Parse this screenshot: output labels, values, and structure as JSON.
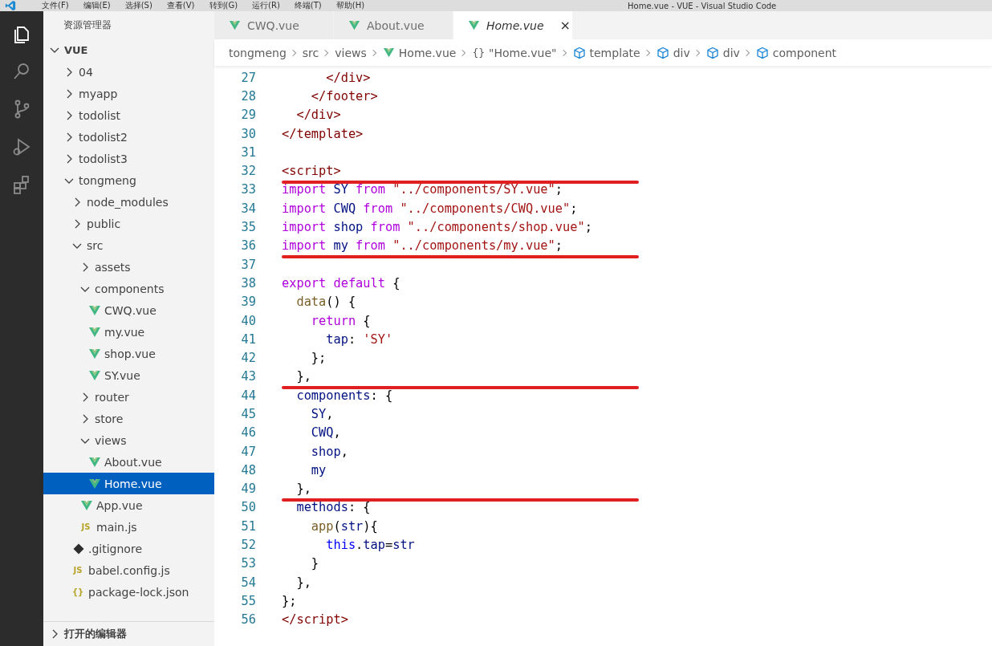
{
  "menu_bar": {
    "items": [
      "文件(F)",
      "编辑(E)",
      "选择(S)",
      "查看(V)",
      "转到(G)",
      "运行(R)",
      "终端(T)",
      "帮助(H)"
    ],
    "title": "Home.vue - VUE - Visual Studio Code"
  },
  "activity_bar": [
    {
      "kind": "files",
      "selected": true
    },
    {
      "kind": "search",
      "selected": false
    },
    {
      "kind": "source-control",
      "selected": false
    },
    {
      "kind": "run",
      "selected": false
    },
    {
      "kind": "extensions",
      "selected": false
    }
  ],
  "sidebar": {
    "title": "资源管理器",
    "root": {
      "label": "VUE",
      "expanded": true
    },
    "items": [
      {
        "label": "04",
        "kind": "folder",
        "expanded": false,
        "selected": false
      },
      {
        "label": "myapp",
        "kind": "folder",
        "expanded": false,
        "selected": false
      },
      {
        "label": "todolist",
        "kind": "folder",
        "expanded": false,
        "selected": false
      },
      {
        "label": "todolist2",
        "kind": "folder",
        "expanded": false,
        "selected": false
      },
      {
        "label": "todolist3",
        "kind": "folder",
        "expanded": false,
        "selected": false
      },
      {
        "label": "tongmeng",
        "kind": "folder",
        "expanded": true,
        "selected": false,
        "children": [
          {
            "label": "node_modules",
            "kind": "folder",
            "expanded": false,
            "selected": false
          },
          {
            "label": "public",
            "kind": "folder",
            "expanded": false,
            "selected": false
          },
          {
            "label": "src",
            "kind": "folder",
            "expanded": true,
            "selected": false,
            "children": [
              {
                "label": "assets",
                "kind": "folder",
                "expanded": false,
                "selected": false
              },
              {
                "label": "components",
                "kind": "folder",
                "expanded": true,
                "selected": false,
                "children": [
                  {
                    "label": "CWQ.vue",
                    "kind": "vue",
                    "selected": false
                  },
                  {
                    "label": "my.vue",
                    "kind": "vue",
                    "selected": false
                  },
                  {
                    "label": "shop.vue",
                    "kind": "vue",
                    "selected": false
                  },
                  {
                    "label": "SY.vue",
                    "kind": "vue",
                    "selected": false
                  }
                ]
              },
              {
                "label": "router",
                "kind": "folder",
                "expanded": false,
                "selected": false
              },
              {
                "label": "store",
                "kind": "folder",
                "expanded": false,
                "selected": false
              },
              {
                "label": "views",
                "kind": "folder",
                "expanded": true,
                "selected": false,
                "children": [
                  {
                    "label": "About.vue",
                    "kind": "vue",
                    "selected": false
                  },
                  {
                    "label": "Home.vue",
                    "kind": "vue",
                    "selected": true
                  }
                ]
              },
              {
                "label": "App.vue",
                "kind": "vue",
                "selected": false
              },
              {
                "label": "main.js",
                "kind": "badge",
                "badge": "JS",
                "selected": false
              }
            ]
          },
          {
            "label": ".gitignore",
            "kind": "git",
            "selected": false
          },
          {
            "label": "babel.config.js",
            "kind": "badge",
            "badge": "JS",
            "selected": false
          },
          {
            "label": "package-lock.json",
            "kind": "badge",
            "badge": "{}",
            "selected": false
          }
        ]
      }
    ],
    "open_editors": {
      "label": "打开的编辑器",
      "expanded": false
    }
  },
  "tabs": [
    {
      "label": "CWQ.vue",
      "selected": false,
      "preview": false
    },
    {
      "label": "About.vue",
      "selected": false,
      "preview": false
    },
    {
      "label": "Home.vue",
      "selected": true,
      "preview": true,
      "close": "×"
    }
  ],
  "breadcrumb": [
    {
      "label": "tongmeng",
      "kind": "text"
    },
    {
      "label": "src",
      "kind": "text"
    },
    {
      "label": "views",
      "kind": "text"
    },
    {
      "label": "Home.vue",
      "kind": "vue"
    },
    {
      "label": "\"Home.vue\"",
      "kind": "badge",
      "badge": "{}"
    },
    {
      "label": "template",
      "kind": "cube"
    },
    {
      "label": "div",
      "kind": "cube"
    },
    {
      "label": "div",
      "kind": "cube"
    },
    {
      "label": "component",
      "kind": "cube"
    }
  ],
  "editor": {
    "lines": [
      {
        "number": "27",
        "underlined": false,
        "tokens": [
          {
            "kind": "tag",
            "t": "      </div>"
          }
        ]
      },
      {
        "number": "28",
        "underlined": false,
        "tokens": [
          {
            "kind": "tag",
            "t": "    </footer>"
          }
        ]
      },
      {
        "number": "29",
        "underlined": false,
        "tokens": [
          {
            "kind": "tag",
            "t": "  </div>"
          }
        ]
      },
      {
        "number": "30",
        "underlined": false,
        "tokens": [
          {
            "kind": "tag",
            "t": "</template>"
          }
        ]
      },
      {
        "number": "31",
        "underlined": false
      },
      {
        "number": "32",
        "underlined": true,
        "tokens": [
          {
            "kind": "tag",
            "t": "<script>"
          }
        ]
      },
      {
        "number": "33",
        "underlined": false,
        "tokens": [
          {
            "kind": "keyword",
            "t": "import "
          },
          {
            "kind": "var",
            "t": "SY "
          },
          {
            "kind": "keyword",
            "t": "from "
          },
          {
            "kind": "string",
            "t": "\"../components/SY.vue\""
          },
          {
            "kind": "plain",
            "t": ";"
          }
        ]
      },
      {
        "number": "34",
        "underlined": false,
        "tokens": [
          {
            "kind": "keyword",
            "t": "import "
          },
          {
            "kind": "var",
            "t": "CWQ "
          },
          {
            "kind": "keyword",
            "t": "from "
          },
          {
            "kind": "string",
            "t": "\"../components/CWQ.vue\""
          },
          {
            "kind": "plain",
            "t": ";"
          }
        ]
      },
      {
        "number": "35",
        "underlined": false,
        "tokens": [
          {
            "kind": "keyword",
            "t": "import "
          },
          {
            "kind": "var",
            "t": "shop "
          },
          {
            "kind": "keyword",
            "t": "from "
          },
          {
            "kind": "string",
            "t": "\"../components/shop.vue\""
          },
          {
            "kind": "plain",
            "t": ";"
          }
        ]
      },
      {
        "number": "36",
        "underlined": true,
        "tokens": [
          {
            "kind": "keyword",
            "t": "import "
          },
          {
            "kind": "var",
            "t": "my "
          },
          {
            "kind": "keyword",
            "t": "from "
          },
          {
            "kind": "string",
            "t": "\"../components/my.vue\""
          },
          {
            "kind": "plain",
            "t": ";"
          }
        ]
      },
      {
        "number": "37",
        "underlined": false
      },
      {
        "number": "38",
        "underlined": false,
        "tokens": [
          {
            "kind": "keyword",
            "t": "export default "
          },
          {
            "kind": "plain",
            "t": "{"
          }
        ]
      },
      {
        "number": "39",
        "underlined": false,
        "tokens": [
          {
            "kind": "func",
            "t": "  data"
          },
          {
            "kind": "plain",
            "t": "() {"
          }
        ]
      },
      {
        "number": "40",
        "underlined": false,
        "tokens": [
          {
            "kind": "keyword",
            "t": "    return "
          },
          {
            "kind": "plain",
            "t": "{"
          }
        ]
      },
      {
        "number": "41",
        "underlined": false,
        "tokens": [
          {
            "kind": "var",
            "t": "      tap"
          },
          {
            "kind": "plain",
            "t": ": "
          },
          {
            "kind": "string",
            "t": "'SY'"
          }
        ]
      },
      {
        "number": "42",
        "underlined": false,
        "tokens": [
          {
            "kind": "plain",
            "t": "    };"
          }
        ]
      },
      {
        "number": "43",
        "underlined": true,
        "tokens": [
          {
            "kind": "plain",
            "t": "  },"
          }
        ]
      },
      {
        "number": "44",
        "underlined": false,
        "tokens": [
          {
            "kind": "var",
            "t": "  components"
          },
          {
            "kind": "plain",
            "t": ": {"
          }
        ]
      },
      {
        "number": "45",
        "underlined": false,
        "tokens": [
          {
            "kind": "var",
            "t": "    SY"
          },
          {
            "kind": "plain",
            "t": ","
          }
        ]
      },
      {
        "number": "46",
        "underlined": false,
        "tokens": [
          {
            "kind": "var",
            "t": "    CWQ"
          },
          {
            "kind": "plain",
            "t": ","
          }
        ]
      },
      {
        "number": "47",
        "underlined": false,
        "tokens": [
          {
            "kind": "var",
            "t": "    shop"
          },
          {
            "kind": "plain",
            "t": ","
          }
        ]
      },
      {
        "number": "48",
        "underlined": false,
        "tokens": [
          {
            "kind": "var",
            "t": "    my"
          }
        ]
      },
      {
        "number": "49",
        "underlined": true,
        "tokens": [
          {
            "kind": "plain",
            "t": "  },"
          }
        ]
      },
      {
        "number": "50",
        "underlined": false,
        "tokens": [
          {
            "kind": "var",
            "t": "  methods"
          },
          {
            "kind": "plain",
            "t": ": {"
          }
        ]
      },
      {
        "number": "51",
        "underlined": false,
        "tokens": [
          {
            "kind": "func",
            "t": "    app"
          },
          {
            "kind": "plain",
            "t": "("
          },
          {
            "kind": "var",
            "t": "str"
          },
          {
            "kind": "plain",
            "t": "){"
          }
        ]
      },
      {
        "number": "52",
        "underlined": false,
        "tokens": [
          {
            "kind": "this",
            "t": "      this"
          },
          {
            "kind": "plain",
            "t": "."
          },
          {
            "kind": "var",
            "t": "tap"
          },
          {
            "kind": "plain",
            "t": "="
          },
          {
            "kind": "var",
            "t": "str"
          }
        ]
      },
      {
        "number": "53",
        "underlined": false,
        "tokens": [
          {
            "kind": "plain",
            "t": "    }"
          }
        ]
      },
      {
        "number": "54",
        "underlined": false,
        "tokens": [
          {
            "kind": "plain",
            "t": "  },"
          }
        ]
      },
      {
        "number": "55",
        "underlined": false,
        "tokens": [
          {
            "kind": "plain",
            "t": "};"
          }
        ]
      },
      {
        "number": "56",
        "underlined": false,
        "tokens": [
          {
            "kind": "tag",
            "t": "</script>"
          }
        ]
      }
    ]
  }
}
